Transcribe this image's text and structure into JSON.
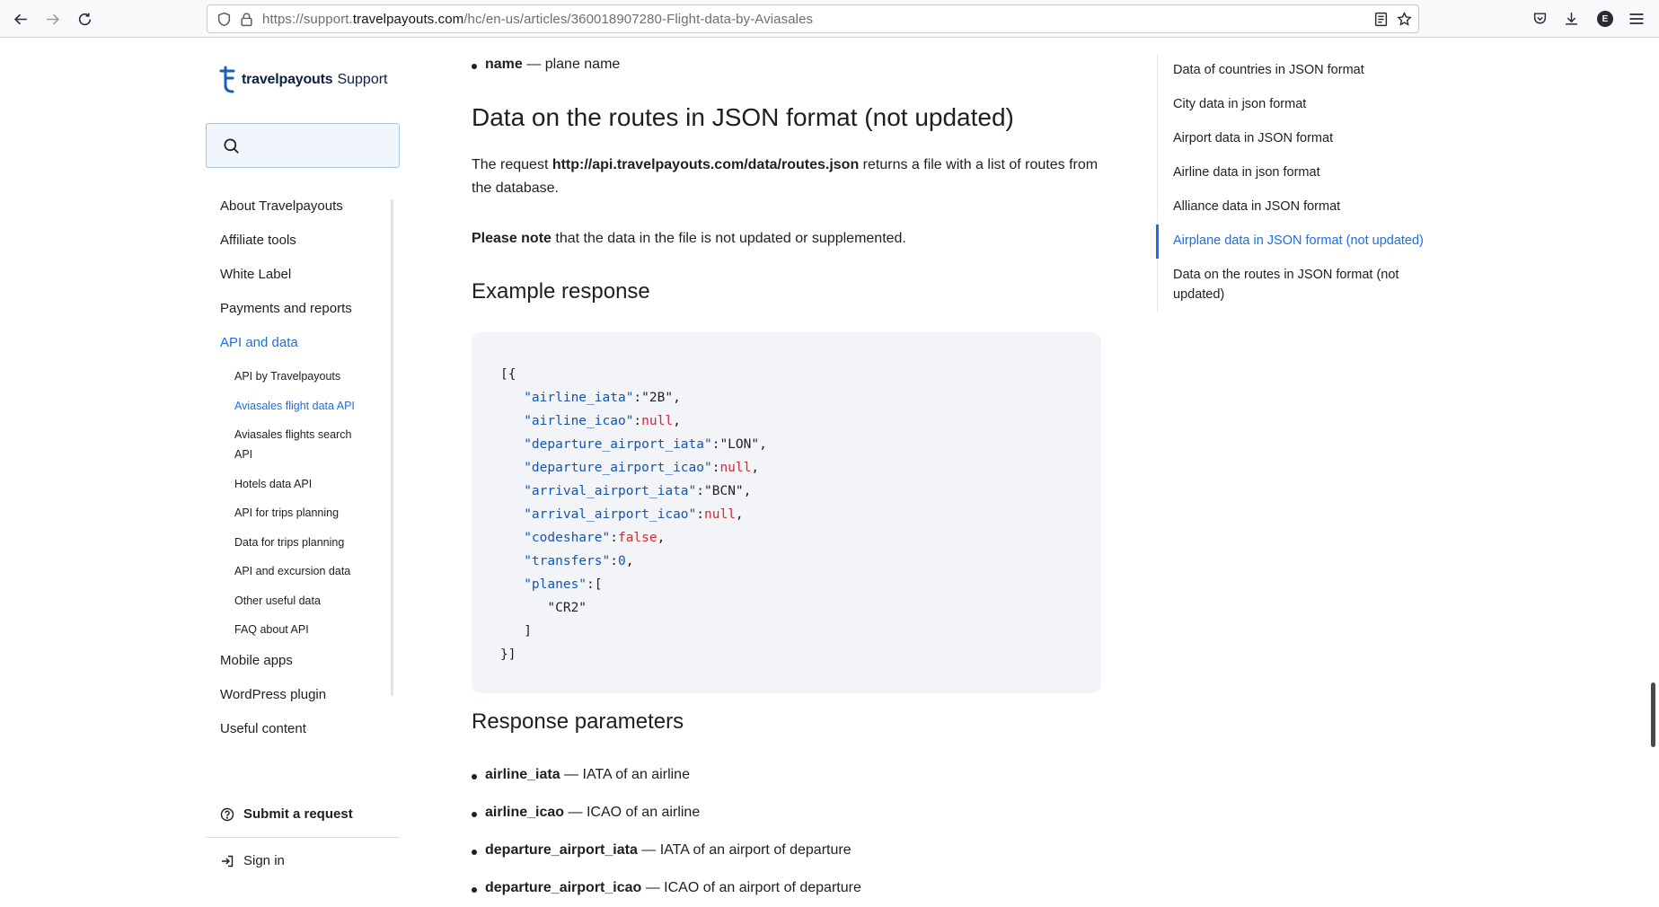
{
  "browser": {
    "url_prefix": "https://support.",
    "url_domain": "travelpayouts.com",
    "url_path": "/hc/en-us/articles/360018907280-Flight-data-by-Aviasales",
    "profile_initial": "E"
  },
  "logo": {
    "brand": "travelpayouts",
    "suffix": "Support"
  },
  "search": {
    "placeholder": ""
  },
  "sidebar": {
    "items": [
      {
        "label": "About Travelpayouts"
      },
      {
        "label": "Affiliate tools"
      },
      {
        "label": "White Label"
      },
      {
        "label": "Payments and reports"
      },
      {
        "label": "API and data"
      }
    ],
    "subitems": [
      {
        "label": "API by Travelpayouts"
      },
      {
        "label": "Aviasales flight data API"
      },
      {
        "label": "Aviasales flights search API"
      },
      {
        "label": "Hotels data API"
      },
      {
        "label": "API for trips planning"
      },
      {
        "label": "Data for trips planning"
      },
      {
        "label": "API and excursion data"
      },
      {
        "label": "Other useful data"
      },
      {
        "label": "FAQ about API"
      }
    ],
    "items_after": [
      {
        "label": "Mobile apps"
      },
      {
        "label": "WordPress plugin"
      },
      {
        "label": "Useful content"
      }
    ],
    "submit_request": "Submit a request",
    "sign_in": "Sign in"
  },
  "article": {
    "top_bullet": {
      "term": "name",
      "desc": " — plane name"
    },
    "heading": "Data on the routes in JSON format (not updated)",
    "p1_prefix": "The request ",
    "p1_link": "http://api.travelpayouts.com/data/routes.json",
    "p1_suffix": " returns a file with a list of routes from the database.",
    "p2_bold": "Please note",
    "p2_rest": " that the data in the file is not updated or supplemented.",
    "example_heading": "Example response",
    "code": {
      "open": "[{",
      "lines": [
        {
          "key": "\"airline_iata\"",
          "value": "\"2B\"",
          "type": "s",
          "comma": ","
        },
        {
          "key": "\"airline_icao\"",
          "value": "null",
          "type": "n",
          "comma": ","
        },
        {
          "key": "\"departure_airport_iata\"",
          "value": "\"LON\"",
          "type": "s",
          "comma": ","
        },
        {
          "key": "\"departure_airport_icao\"",
          "value": "null",
          "type": "n",
          "comma": ","
        },
        {
          "key": "\"arrival_airport_iata\"",
          "value": "\"BCN\"",
          "type": "s",
          "comma": ","
        },
        {
          "key": "\"arrival_airport_icao\"",
          "value": "null",
          "type": "n",
          "comma": ","
        },
        {
          "key": "\"codeshare\"",
          "value": "false",
          "type": "n",
          "comma": ","
        },
        {
          "key": "\"transfers\"",
          "value": "0",
          "type": "num",
          "comma": ","
        },
        {
          "key": "\"planes\"",
          "value": "[",
          "type": "s",
          "comma": ""
        }
      ],
      "plane_value": "\"CR2\"",
      "close_array": "]",
      "close": "}]"
    },
    "params_heading": "Response parameters",
    "params": [
      {
        "term": "airline_iata",
        "desc": " — IATA of an airline"
      },
      {
        "term": "airline_icao",
        "desc": " — ICAO of an airline"
      },
      {
        "term": "departure_airport_iata",
        "desc": " — IATA of an airport of departure"
      },
      {
        "term": "departure_airport_icao",
        "desc": " — ICAO of an airport of departure"
      }
    ]
  },
  "toc": [
    {
      "label": "Data of countries in JSON format"
    },
    {
      "label": "City data in json format"
    },
    {
      "label": "Airport data in JSON format"
    },
    {
      "label": "Airline data in json format"
    },
    {
      "label": "Alliance data in JSON format"
    },
    {
      "label": "Airplane data in JSON format (not updated)"
    },
    {
      "label": "Data on the routes in JSON format (not updated)"
    }
  ],
  "colors": {
    "accent": "#1d6ee8",
    "code_bg": "#f2f4f7",
    "json_key": "#1755a8",
    "json_literal": "#d02b35"
  }
}
